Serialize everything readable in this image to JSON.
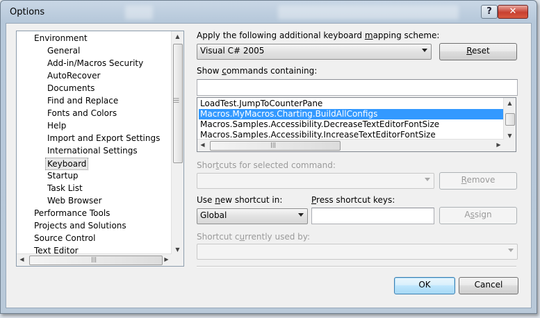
{
  "window": {
    "title": "Options"
  },
  "titlebar_buttons": {
    "help": "?",
    "close": "✕"
  },
  "tree": {
    "items": [
      {
        "label": "Environment",
        "level": 0
      },
      {
        "label": "General",
        "level": 1
      },
      {
        "label": "Add-in/Macros Security",
        "level": 1
      },
      {
        "label": "AutoRecover",
        "level": 1
      },
      {
        "label": "Documents",
        "level": 1
      },
      {
        "label": "Find and Replace",
        "level": 1
      },
      {
        "label": "Fonts and Colors",
        "level": 1
      },
      {
        "label": "Help",
        "level": 1
      },
      {
        "label": "Import and Export Settings",
        "level": 1
      },
      {
        "label": "International Settings",
        "level": 1
      },
      {
        "label": "Keyboard",
        "level": 1,
        "selected": true
      },
      {
        "label": "Startup",
        "level": 1
      },
      {
        "label": "Task List",
        "level": 1
      },
      {
        "label": "Web Browser",
        "level": 1
      },
      {
        "label": "Performance Tools",
        "level": 0
      },
      {
        "label": "Projects and Solutions",
        "level": 0
      },
      {
        "label": "Source Control",
        "level": 0
      },
      {
        "label": "Text Editor",
        "level": 0
      }
    ]
  },
  "mapping": {
    "label_pre": "Apply the following additional keyboard ",
    "label_u": "m",
    "label_post": "apping scheme:",
    "value": "Visual C# 2005",
    "reset_u": "R",
    "reset_rest": "eset"
  },
  "commands": {
    "label_pre": "Show ",
    "label_u": "c",
    "label_post": "ommands containing:",
    "filter_value": "",
    "items": [
      "LoadTest.JumpToCounterPane",
      "Macros.MyMacros.Charting.BuildAllConfigs",
      "Macros.Samples.Accessibility.DecreaseTextEditorFontSize",
      "Macros.Samples.Accessibility.IncreaseTextEditorFontSize"
    ],
    "selected_index": 1
  },
  "shortcuts": {
    "label_pre": "Shor",
    "label_u": "t",
    "label_post": "cuts for selected command:",
    "value": "",
    "remove_u": "R",
    "remove_rest": "emove"
  },
  "scope": {
    "label_pre": "Use ",
    "label_u": "n",
    "label_post": "ew shortcut in:",
    "value": "Global"
  },
  "keys": {
    "label_u": "P",
    "label_post": "ress shortcut keys:",
    "value": "",
    "assign_u": "s",
    "assign_pre": "A",
    "assign_post": "sign"
  },
  "used_by": {
    "label_pre": "Shortcut c",
    "label_u": "u",
    "label_post": "rrently used by:",
    "value": ""
  },
  "footer": {
    "ok": "OK",
    "cancel": "Cancel"
  },
  "icons": {
    "scroll_up": "▲",
    "scroll_down": "▼",
    "scroll_left": "◀",
    "scroll_right": "▶",
    "grip": "|||"
  }
}
